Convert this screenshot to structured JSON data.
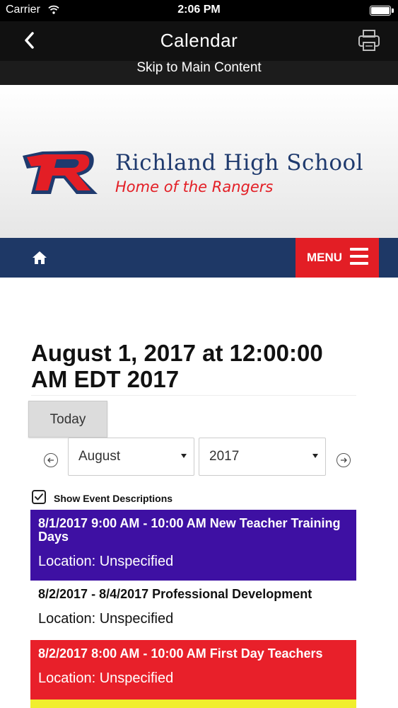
{
  "status_bar": {
    "carrier": "Carrier",
    "time": "2:06 PM"
  },
  "nav_bar": {
    "title": "Calendar"
  },
  "skip_link": "Skip to Main Content",
  "header": {
    "school_name": "Richland High School",
    "tagline": "Home of the Rangers",
    "colors": {
      "navy": "#1e3866",
      "red": "#e31e25"
    }
  },
  "menu_bar": {
    "menu_label": "MENU"
  },
  "calendar": {
    "heading": "August 1, 2017 at 12:00:00 AM EDT 2017",
    "today_label": "Today",
    "month_value": "August",
    "year_value": "2017",
    "show_descriptions_label": "Show Event Descriptions",
    "show_descriptions_checked": true
  },
  "events": [
    {
      "title": "8/1/2017 9:00 AM - 10:00 AM New Teacher Training Days",
      "location": "Location: Unspecified",
      "color": "#3e10a3"
    },
    {
      "title": "8/2/2017 - 8/4/2017 Professional Development",
      "location": "Location: Unspecified",
      "color": "#ffffff"
    },
    {
      "title": "8/2/2017 8:00 AM - 10:00 AM First Day Teachers",
      "location": "Location: Unspecified",
      "color": "#e8202a"
    },
    {
      "title": "",
      "location": "",
      "color": "#f0ee2d"
    }
  ]
}
